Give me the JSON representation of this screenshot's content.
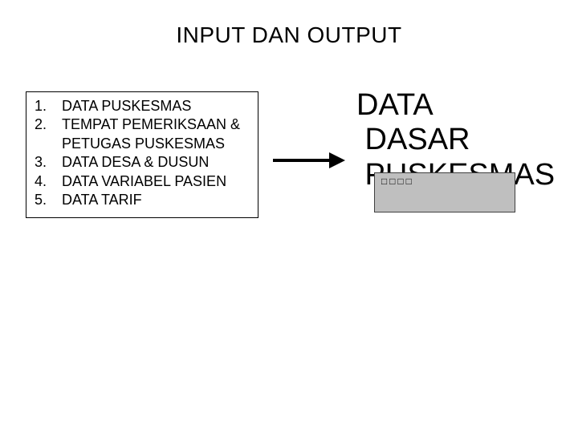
{
  "title": "INPUT DAN OUTPUT",
  "list": {
    "items": [
      {
        "num": "1.",
        "text": "DATA PUSKESMAS"
      },
      {
        "num": "2.",
        "text": "TEMPAT PEMERIKSAAN & PETUGAS PUSKESMAS"
      },
      {
        "num": "3.",
        "text": "DATA DESA & DUSUN"
      },
      {
        "num": "4.",
        "text": "DATA VARIABEL PASIEN"
      },
      {
        "num": "5.",
        "text": "DATA TARIF"
      }
    ]
  },
  "output_label": "DATA\n DASAR\n PUSKESMAS",
  "grey_box_text": "□□□□"
}
